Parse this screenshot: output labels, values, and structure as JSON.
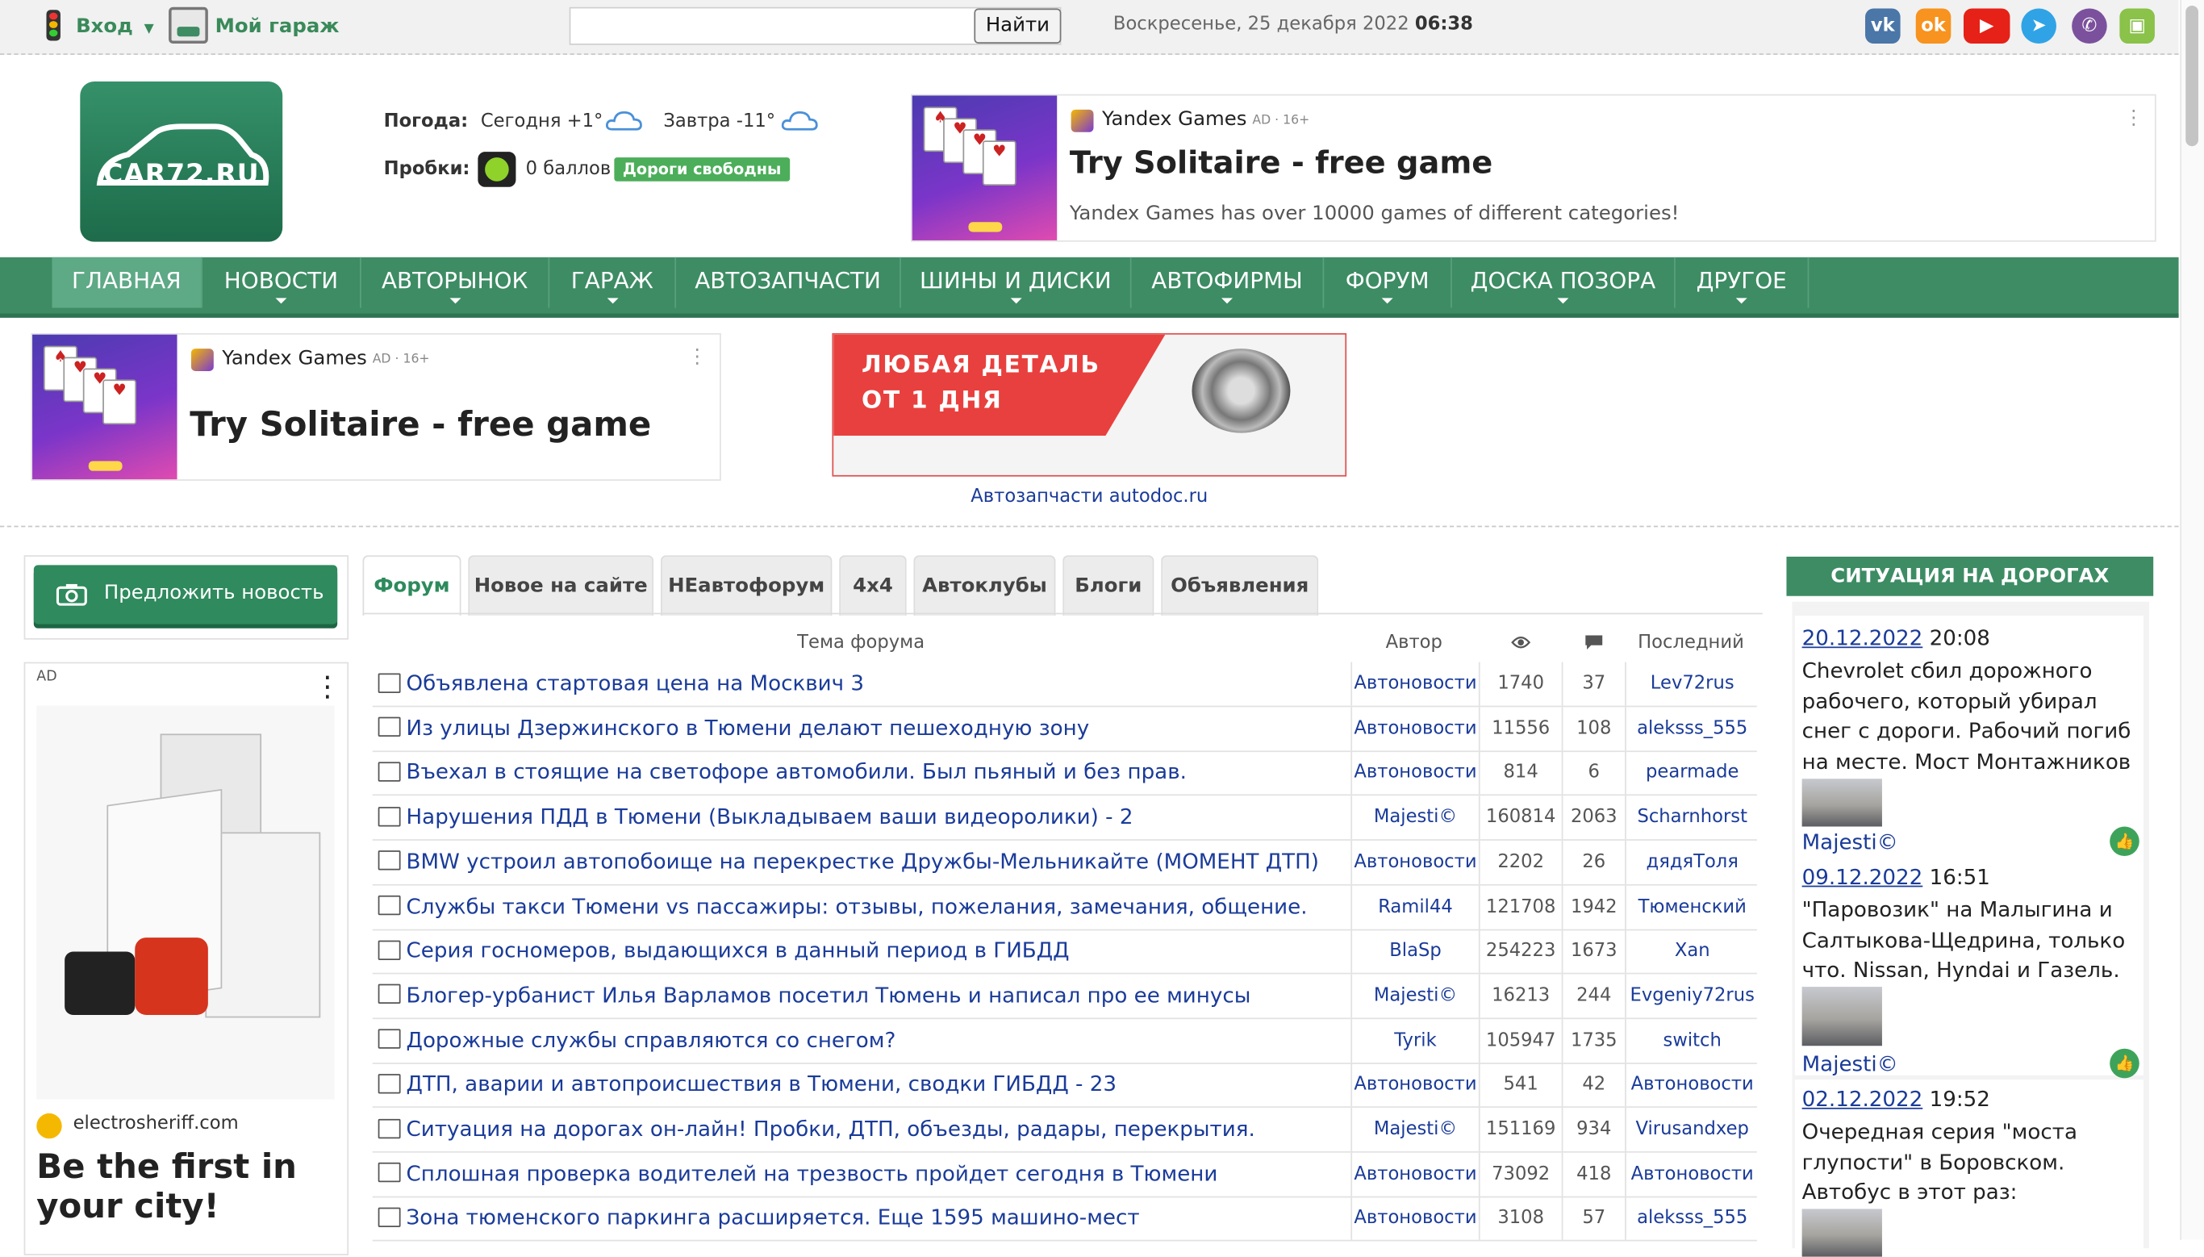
{
  "topbar": {
    "login": "Вход",
    "garage": "Мой гараж",
    "search_button": "Найти",
    "date_text": "Воскресенье, 25 декабря 2022",
    "time_text": "06:38",
    "social": [
      "vk-icon",
      "ok-icon",
      "youtube-icon",
      "telegram-icon",
      "viber-icon",
      "android-icon"
    ],
    "social_colors": [
      "#4a76a8",
      "#f7931e",
      "#e62117",
      "#30a3e6",
      "#7b519d",
      "#8ac24a"
    ]
  },
  "logo": {
    "text": "CAR72.RU"
  },
  "weather": {
    "label": "Погода:",
    "today": "Сегодня +1°",
    "tomorrow": "Завтра -11°",
    "traffic_label": "Пробки:",
    "traffic_value": "0 баллов",
    "traffic_status": "Дороги свободны"
  },
  "ad_top": {
    "brand": "Yandex Games",
    "badge": "AD · 16+",
    "title": "Try Solitaire - free game",
    "desc": "Yandex Games has over 10000 games of different categories!"
  },
  "nav": [
    "ГЛАВНАЯ",
    "НОВОСТИ",
    "АВТОРЫНОК",
    "ГАРАЖ",
    "АВТОЗАПЧАСТИ",
    "ШИНЫ И ДИСКИ",
    "АВТОФИРМЫ",
    "ФОРУМ",
    "ДОСКА ПОЗОРА",
    "ДРУГОЕ"
  ],
  "ad_second": {
    "brand": "Yandex Games",
    "badge": "AD · 16+",
    "title": "Try Solitaire - free game"
  },
  "autodoc": {
    "banner_line1": "ЛЮБАЯ ДЕТАЛЬ",
    "banner_line2": "ОТ 1 ДНЯ",
    "caption": "Автозапчасти autodoc.ru"
  },
  "left": {
    "suggest": "Предложить новость",
    "ad_label": "AD",
    "ad_domain": "electrosheriff.com",
    "ad_title": "Be the first in your city!"
  },
  "tabs": [
    "Форум",
    "Новое на сайте",
    "НЕавтофорум",
    "4x4",
    "Автоклубы",
    "Блоги",
    "Объявления"
  ],
  "table": {
    "headers": {
      "topic": "Тема форума",
      "author": "Автор",
      "last": "Последний"
    },
    "rows": [
      {
        "topic": "Объявлена стартовая цена на Москвич 3",
        "author": "Автоновости",
        "views": "1740",
        "replies": "37",
        "last": "Lev72rus"
      },
      {
        "topic": "Из улицы Дзержинского в Тюмени делают пешеходную зону",
        "author": "Автоновости",
        "views": "11556",
        "replies": "108",
        "last": "aleksss_555"
      },
      {
        "topic": "Въехал в стоящие на светофоре автомобили. Был пьяный и без прав.",
        "author": "Автоновости",
        "views": "814",
        "replies": "6",
        "last": "pearmade"
      },
      {
        "topic": "Нарушения ПДД в Тюмени (Выкладываем ваши видеоролики) - 2",
        "author": "Majesti©",
        "views": "160814",
        "replies": "2063",
        "last": "Scharnhorst"
      },
      {
        "topic": "BMW устроил автопобоище на перекрестке Дружбы-Мельникайте (МОМЕНТ ДТП)",
        "author": "Автоновости",
        "views": "2202",
        "replies": "26",
        "last": "дядяТоля"
      },
      {
        "topic": "Службы такси Тюмени vs пассажиры: отзывы, пожелания, замечания, общение.",
        "author": "Ramil44",
        "views": "121708",
        "replies": "1942",
        "last": "Тюменский"
      },
      {
        "topic": "Серия госномеров, выдающихся в данный период в ГИБДД",
        "author": "BlaSp",
        "views": "254223",
        "replies": "1673",
        "last": "Xan"
      },
      {
        "topic": "Блогер-урбанист Илья Варламов посетил Тюмень и написал про ее минусы",
        "author": "Majesti©",
        "views": "16213",
        "replies": "244",
        "last": "Evgeniy72rus"
      },
      {
        "topic": "Дорожные службы справляются со снегом?",
        "author": "Tyrik",
        "views": "105947",
        "replies": "1735",
        "last": "switch"
      },
      {
        "topic": "ДТП, аварии и автопроисшествия в Тюмени, сводки ГИБДД - 23",
        "author": "Автоновости",
        "views": "541",
        "replies": "42",
        "last": "Автоновости"
      },
      {
        "topic": "Ситуация на дорогах он-лайн! Пробки, ДТП, объезды, радары, перекрытия.",
        "author": "Majesti©",
        "views": "151169",
        "replies": "934",
        "last": "Virusandxep"
      },
      {
        "topic": "Сплошная проверка водителей на трезвость пройдет сегодня в Тюмени",
        "author": "Автоновости",
        "views": "73092",
        "replies": "418",
        "last": "Автоновости"
      },
      {
        "topic": "Зона тюменского паркинга расширяется. Еще 1595 машино-мест",
        "author": "Автоновости",
        "views": "3108",
        "replies": "57",
        "last": "aleksss_555"
      }
    ]
  },
  "right": {
    "title": "СИТУАЦИЯ НА ДОРОГАХ",
    "news": [
      {
        "date": "20.12.2022",
        "time": "20:08",
        "lines": [
          "Chevrolet сбил дорожного",
          "рабочего, который убирал",
          "снег с дороги. Рабочий погиб",
          "на месте. Мост Монтажников"
        ],
        "author": "Majesti©"
      },
      {
        "date": "09.12.2022",
        "time": "16:51",
        "lines": [
          "\"Паровозик\" на Малыгина и",
          "Салтыкова-Щедрина, только",
          "что. Nissan, Hyndai и Газель."
        ],
        "author": "Majesti©"
      },
      {
        "date": "02.12.2022",
        "time": "19:52",
        "lines": [
          "Очередная серия \"моста",
          "глупости\" в Боровском.",
          "Автобус в этот раз:"
        ]
      }
    ]
  }
}
